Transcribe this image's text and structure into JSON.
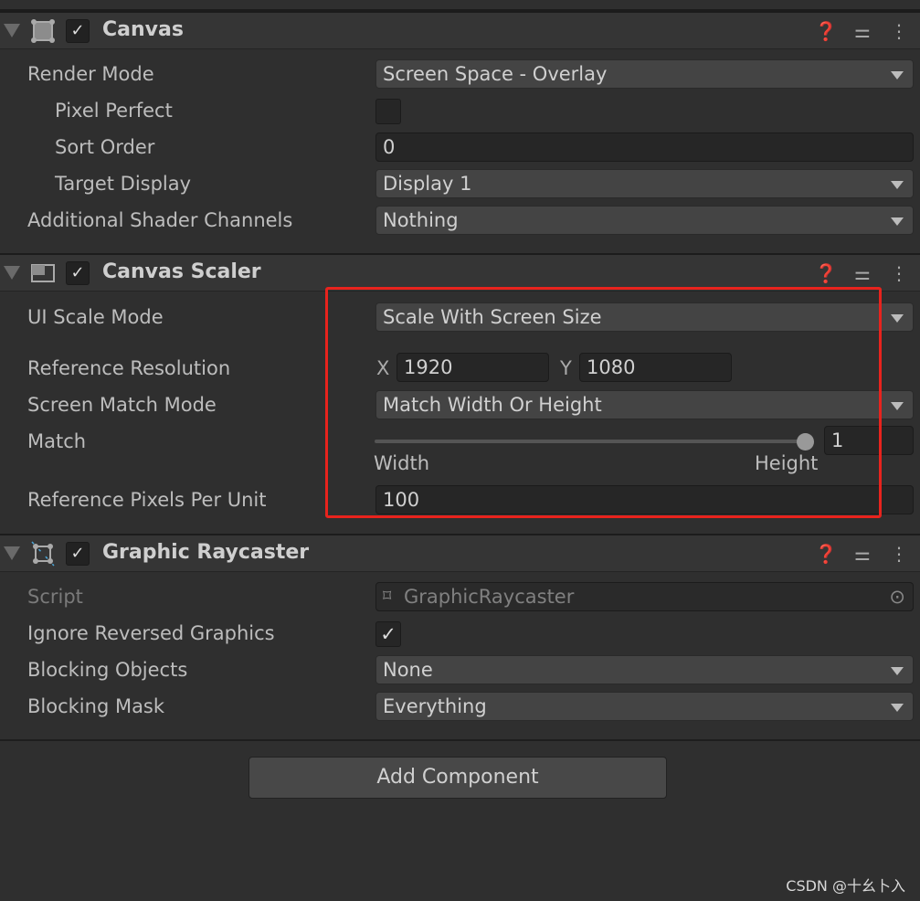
{
  "canvas": {
    "title": "Canvas",
    "enabled": true,
    "render_mode_label": "Render Mode",
    "render_mode": "Screen Space - Overlay",
    "pixel_perfect_label": "Pixel Perfect",
    "pixel_perfect": false,
    "sort_order_label": "Sort Order",
    "sort_order": "0",
    "target_display_label": "Target Display",
    "target_display": "Display 1",
    "shader_channels_label": "Additional Shader Channels",
    "shader_channels": "Nothing"
  },
  "scaler": {
    "title": "Canvas Scaler",
    "enabled": true,
    "scale_mode_label": "UI Scale Mode",
    "scale_mode": "Scale With Screen Size",
    "ref_res_label": "Reference Resolution",
    "x_label": "X",
    "x": "1920",
    "y_label": "Y",
    "y": "1080",
    "match_mode_label": "Screen Match Mode",
    "match_mode": "Match Width Or Height",
    "match_label": "Match",
    "match_value": "1",
    "match_fraction": 1,
    "width_label": "Width",
    "height_label": "Height",
    "ppu_label": "Reference Pixels Per Unit",
    "ppu": "100"
  },
  "raycaster": {
    "title": "Graphic Raycaster",
    "enabled": true,
    "script_label": "Script",
    "script": "GraphicRaycaster",
    "ignore_reversed_label": "Ignore Reversed Graphics",
    "ignore_reversed": true,
    "blocking_objects_label": "Blocking Objects",
    "blocking_objects": "None",
    "blocking_mask_label": "Blocking Mask",
    "blocking_mask": "Everything"
  },
  "add_component": "Add Component",
  "header_icons": [
    "help-icon",
    "preset-sliders-icon",
    "kebab-menu-icon"
  ],
  "watermark": "CSDN @十幺卜入",
  "highlight_color": "#e8231d"
}
